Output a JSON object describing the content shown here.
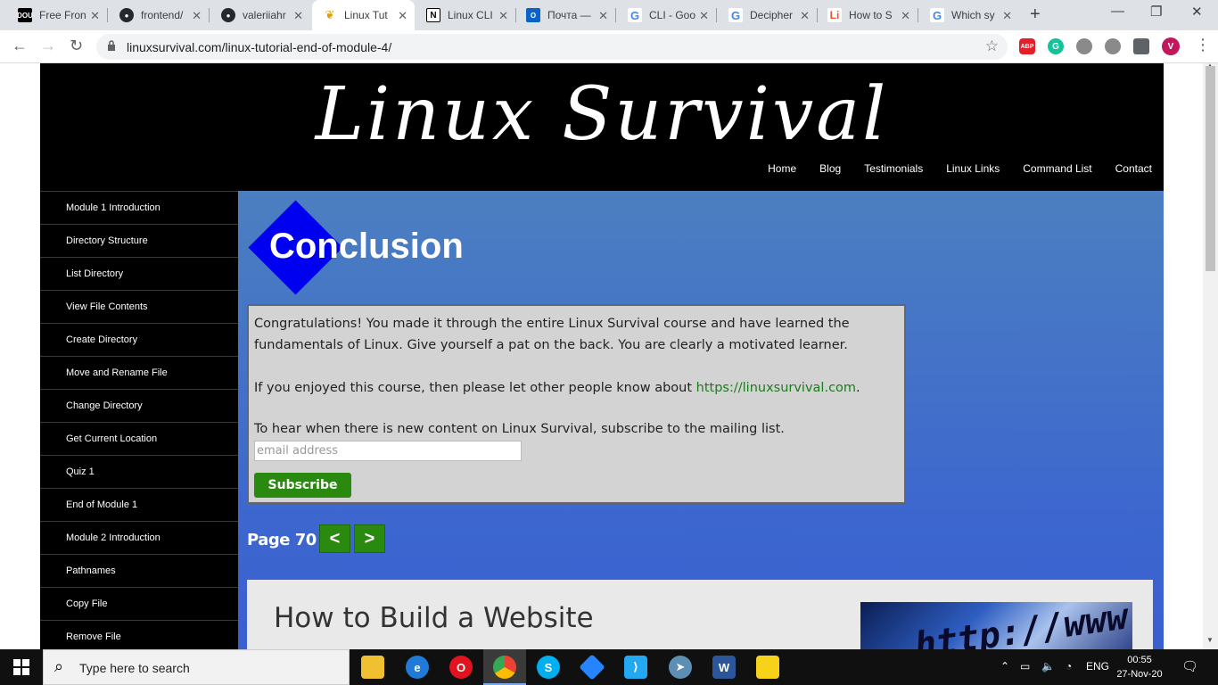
{
  "browser": {
    "tabs": [
      {
        "title": "Free Fron",
        "favicon": "dou-icon",
        "color": "#000000"
      },
      {
        "title": "frontend/",
        "favicon": "github-icon",
        "color": "#24292e"
      },
      {
        "title": "valeriiahr",
        "favicon": "github-icon",
        "color": "#24292e"
      },
      {
        "title": "Linux Tut",
        "favicon": "linuxsurvival-icon",
        "color": "#e0a000"
      },
      {
        "title": "Linux CLI",
        "favicon": "notion-icon",
        "color": "#000000"
      },
      {
        "title": "Почта —",
        "favicon": "outlook-icon",
        "color": "#0a64c8"
      },
      {
        "title": "CLI - Goo",
        "favicon": "google-icon",
        "color": "#4285f4"
      },
      {
        "title": "Decipher",
        "favicon": "google-icon",
        "color": "#4285f4"
      },
      {
        "title": "How to S",
        "favicon": "li-icon",
        "color": "#e8562a"
      },
      {
        "title": "Which sy",
        "favicon": "google-icon",
        "color": "#4285f4"
      }
    ],
    "url": "linuxsurvival.com/linux-tutorial-end-of-module-4/",
    "extensions": [
      {
        "label": "ABP",
        "color": "#e3202a"
      },
      {
        "label": "G",
        "color": "#15c39a"
      },
      {
        "label": "",
        "color": "#8a8a8a"
      },
      {
        "label": "",
        "color": "#8a8a8a"
      },
      {
        "label": "",
        "color": "#5f6368"
      },
      {
        "label": "V",
        "color": "#c2185b"
      }
    ]
  },
  "site": {
    "logo": "Linux Survival",
    "nav": [
      "Home",
      "Blog",
      "Testimonials",
      "Linux Links",
      "Command List",
      "Contact"
    ],
    "sidebar": [
      "Module 1 Introduction",
      "Directory Structure",
      "List Directory",
      "View File Contents",
      "Create Directory",
      "Move and Rename File",
      "Change Directory",
      "Get Current Location",
      "Quiz 1",
      "End of Module 1",
      "Module 2 Introduction",
      "Pathnames",
      "Copy File",
      "Remove File"
    ],
    "heading": "Conclusion",
    "paragraph1": "Congratulations! You made it through the entire Linux Survival course and have learned the fundamentals of Linux. Give yourself a pat on the back. You are clearly a motivated learner.",
    "paragraph2_prefix": "If you enjoyed this course, then please let other people know about ",
    "paragraph2_link": "https://linuxsurvival.com",
    "paragraph2_suffix": ".",
    "paragraph3": "To hear when there is new content on Linux Survival, subscribe to the mailing list.",
    "email_placeholder": "email address",
    "subscribe_label": "Subscribe",
    "page_label": "Page 70",
    "prev_label": "<",
    "next_label": ">",
    "promo_title": "How to Build a Website",
    "promo_image_text": "http://www"
  },
  "taskbar": {
    "search_placeholder": "Type here to search",
    "language": "ENG",
    "time": "00:55",
    "date": "27-Nov-20",
    "apps": [
      {
        "name": "file-explorer-icon",
        "color": "#f0c030"
      },
      {
        "name": "edge-icon",
        "color": "#1f7ad8"
      },
      {
        "name": "opera-icon",
        "color": "#e0131e"
      },
      {
        "name": "chrome-icon",
        "color": "#4caf50"
      },
      {
        "name": "skype-icon",
        "color": "#00aff0"
      },
      {
        "name": "sourcetree-icon",
        "color": "#2684ff"
      },
      {
        "name": "vscode-icon",
        "color": "#23a9f2"
      },
      {
        "name": "telegram-icon",
        "color": "#5d8fb5"
      },
      {
        "name": "word-icon",
        "color": "#2b579a"
      },
      {
        "name": "sticky-notes-icon",
        "color": "#f7d21b"
      }
    ]
  }
}
